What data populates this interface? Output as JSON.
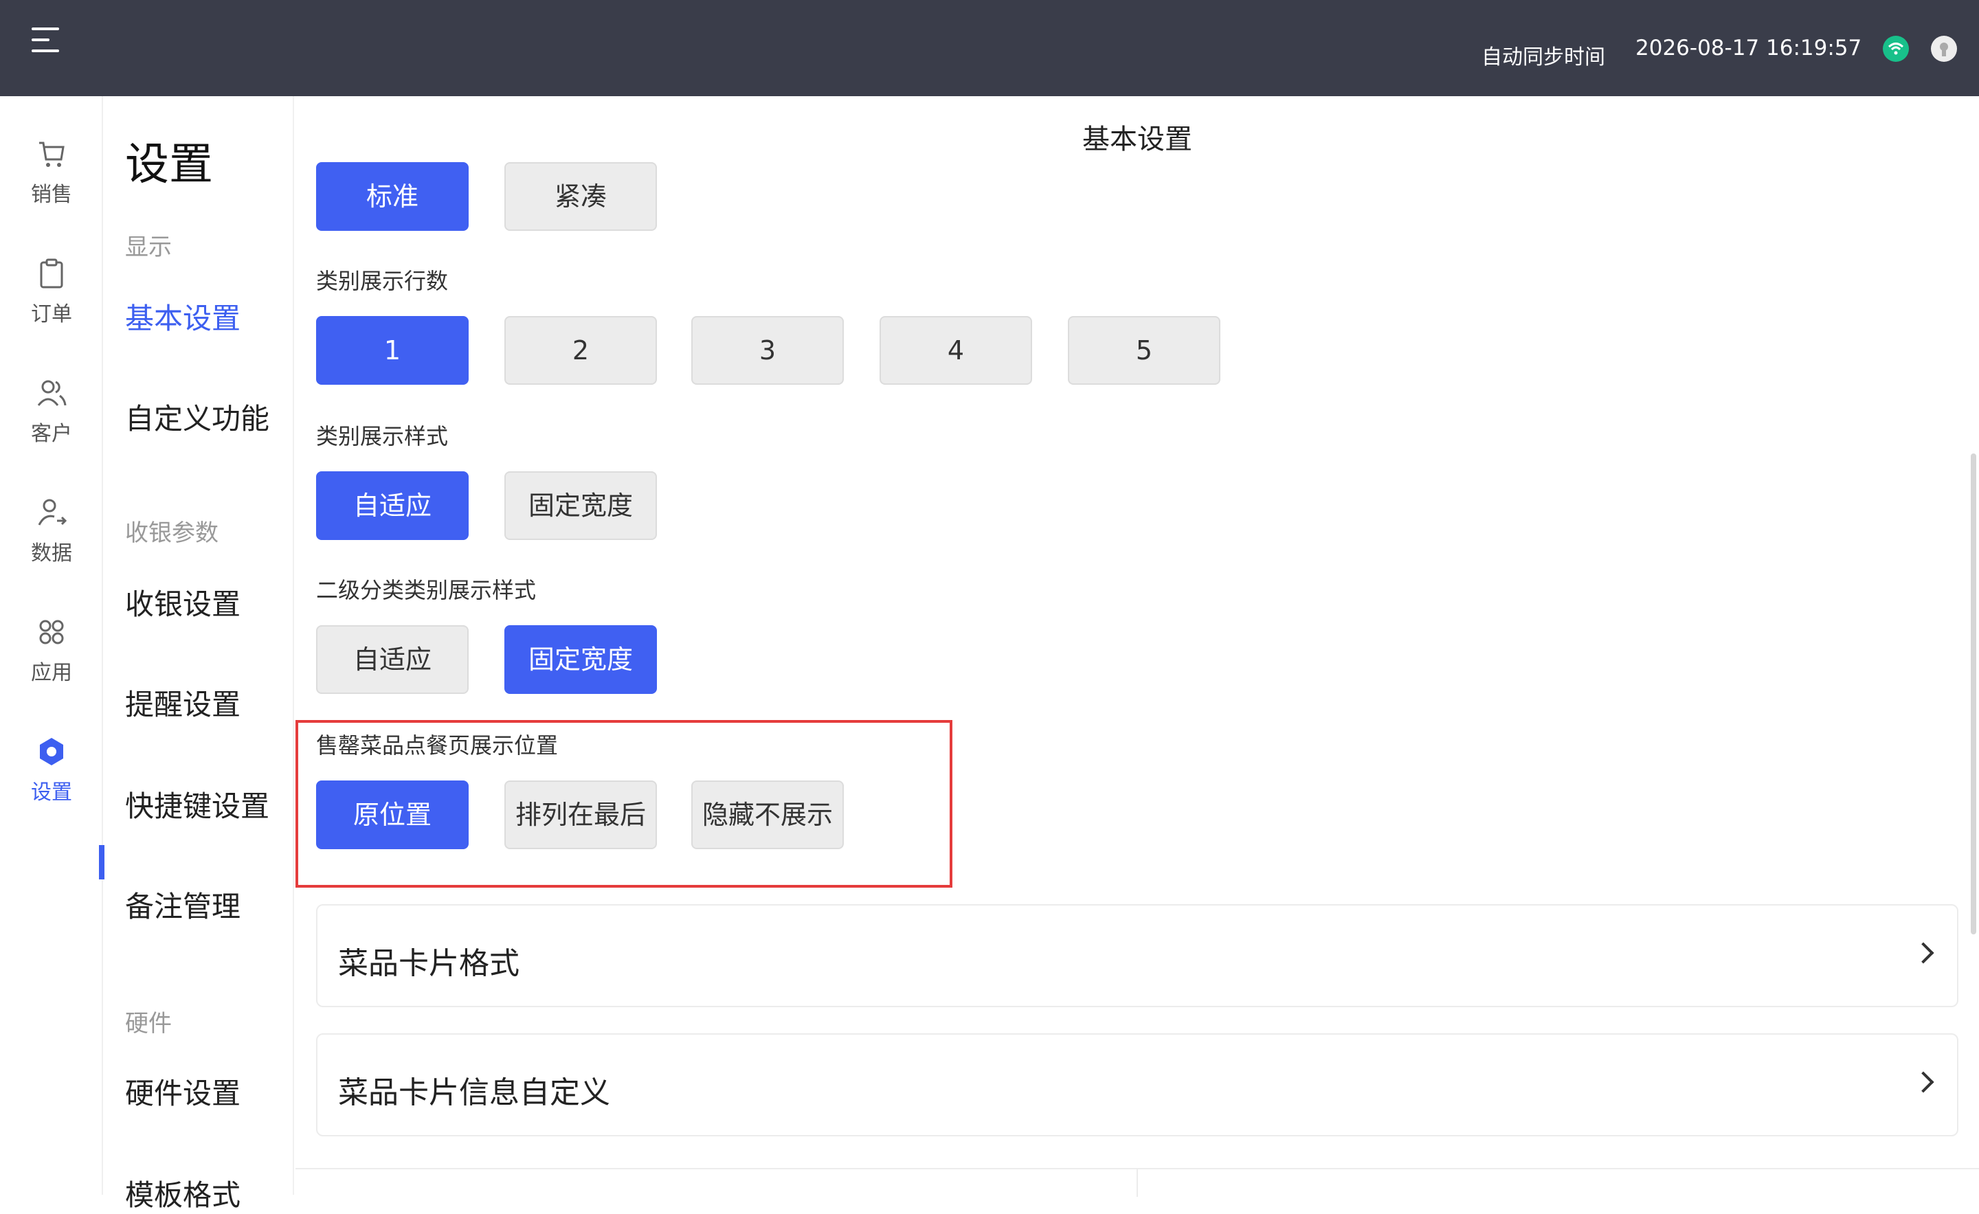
{
  "topbar": {
    "sync_label": "自动同步时间",
    "sync_time": "2026-08-17 16:19:57",
    "colors": {
      "background": "#3a3d4a",
      "wifi": "#18c08a"
    }
  },
  "icon_nav": {
    "items": [
      {
        "label": "销售",
        "icon": "cart-icon"
      },
      {
        "label": "订单",
        "icon": "clipboard-icon"
      },
      {
        "label": "客户",
        "icon": "users-icon"
      },
      {
        "label": "数据",
        "icon": "user-arrow-icon"
      },
      {
        "label": "应用",
        "icon": "apps-grid-icon"
      },
      {
        "label": "设置",
        "icon": "gear-icon",
        "active": true
      }
    ]
  },
  "sub_nav": {
    "title": "设置",
    "groups": [
      {
        "label": "显示"
      },
      {
        "label": "收银参数"
      },
      {
        "label": "硬件"
      }
    ],
    "items": [
      {
        "label": "基本设置",
        "active": true
      },
      {
        "label": "自定义功能"
      },
      {
        "label": "收银设置"
      },
      {
        "label": "提醒设置"
      },
      {
        "label": "快捷键设置"
      },
      {
        "label": "备注管理"
      },
      {
        "label": "硬件设置"
      },
      {
        "label": "模板格式"
      }
    ]
  },
  "main": {
    "title": "基本设置",
    "density": {
      "options": [
        "标准",
        "紧凑"
      ],
      "selected": 0
    },
    "category_rows": {
      "label": "类别展示行数",
      "options": [
        "1",
        "2",
        "3",
        "4",
        "5"
      ],
      "selected": 0
    },
    "category_style": {
      "label": "类别展示样式",
      "options": [
        "自适应",
        "固定宽度"
      ],
      "selected": 0
    },
    "subcategory_style": {
      "label": "二级分类类别展示样式",
      "options": [
        "自适应",
        "固定宽度"
      ],
      "selected": 1
    },
    "soldout_position": {
      "label": "售罄菜品点餐页展示位置",
      "options": [
        "原位置",
        "排列在最后",
        "隐藏不展示"
      ],
      "selected": 0
    },
    "cards": [
      {
        "label": "菜品卡片格式"
      },
      {
        "label": "菜品卡片信息自定义"
      }
    ],
    "accent_color": "#4060f2"
  }
}
